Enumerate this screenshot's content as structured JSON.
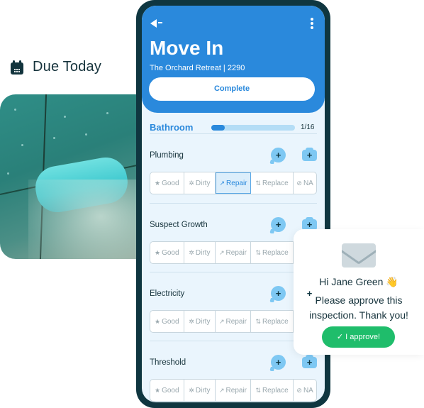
{
  "due": {
    "label": "Due Today",
    "icon": "calendar-icon"
  },
  "photo": {
    "description": "leaking-pipe-photo"
  },
  "header": {
    "title": "Move In",
    "subtitle": "The Orchard Retreat | 2290",
    "complete_label": "Complete",
    "back_icon": "back-arrow-icon",
    "menu_icon": "kebab-menu-icon"
  },
  "section": {
    "name": "Bathroom",
    "progress": "1/16",
    "progress_fraction": 0.0625,
    "accent": "#2a89dc"
  },
  "options": [
    {
      "icon": "★",
      "label": "Good"
    },
    {
      "icon": "✲",
      "label": "Dirty"
    },
    {
      "icon": "↗",
      "label": "Repair"
    },
    {
      "icon": "⇅",
      "label": "Replace"
    },
    {
      "icon": "⊘",
      "label": "NA"
    }
  ],
  "items": [
    {
      "label": "Plumbing",
      "selected": "Repair"
    },
    {
      "label": "Suspect Growth",
      "selected": null
    },
    {
      "label": "Electricity",
      "selected": null
    },
    {
      "label": "Threshold",
      "selected": null
    }
  ],
  "add_symbol": "+",
  "card": {
    "greeting": "Hi Jane Green 👋",
    "message": "Please approve this inspection. Thank you!",
    "approve_label": "✓  I approve!",
    "approve_color": "#1fbd6b"
  }
}
